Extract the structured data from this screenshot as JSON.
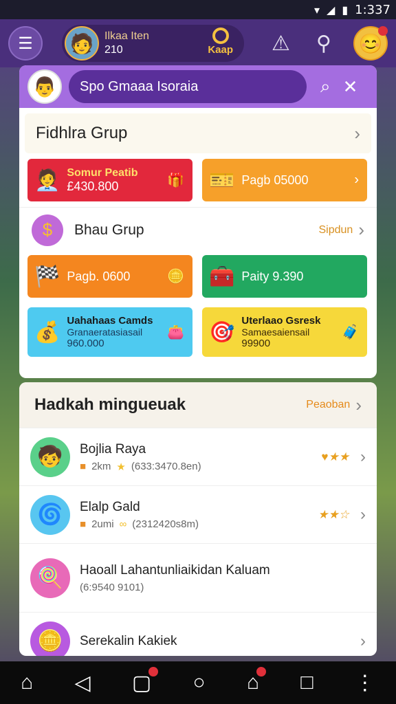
{
  "status_bar": {
    "time": "1:337",
    "wifi_icon": "wifi-icon",
    "signal_icon": "signal-icon",
    "battery_icon": "battery-icon"
  },
  "top_bar": {
    "player_name": "Ilkaa Iten",
    "player_level": "210",
    "coin_label": "Kaap"
  },
  "search": {
    "value": "Spo Gmaaa Isoraia"
  },
  "group1": {
    "title": "Fidhlra Grup",
    "tiles": [
      {
        "title": "Somur Peatib",
        "value": "£430.800"
      },
      {
        "title": "",
        "value": "Pagb 05000"
      }
    ]
  },
  "group2": {
    "title": "Bhau Grup",
    "action": "Sipdun",
    "tiles": [
      {
        "value": "Pagb. 0600"
      },
      {
        "value": "Paity 9.390"
      },
      {
        "title": "Uahahaas Camds",
        "sub": "Granaeratasiasail",
        "value": "960.000"
      },
      {
        "title": "Uterlaao Gsresk",
        "sub": "Samaesaiensail",
        "value": "99900"
      }
    ]
  },
  "list": {
    "title": "Hadkah mingueuak",
    "action": "Peaoban",
    "items": [
      {
        "title": "Bojlia Raya",
        "meta_a": "2km",
        "meta_b": "(633:3470.8en)",
        "rating": "♥★★"
      },
      {
        "title": "Elalp Gald",
        "meta_a": "2umi",
        "meta_b": "(2312420s8m)",
        "rating": "★★☆"
      },
      {
        "title": "Haoall Lahantunliaikidan Kaluam",
        "meta_a": "",
        "meta_b": "(6:9540 9101)",
        "rating": ""
      },
      {
        "title": "Serekalin Kakiek",
        "meta_a": "",
        "meta_b": "",
        "rating": ""
      }
    ]
  },
  "colors": {
    "accent": "#a46de0",
    "red": "#e2283c",
    "orange": "#f6a02a",
    "green": "#22a860"
  }
}
